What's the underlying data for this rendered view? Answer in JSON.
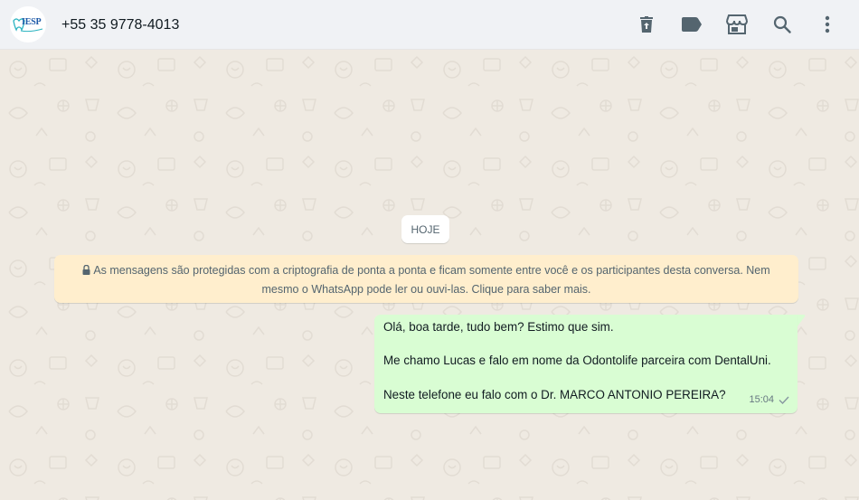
{
  "header": {
    "avatar_logo_text": "IESP",
    "contact_name": "+55 35 9778-4013",
    "icons": [
      "delete-icon",
      "label-icon",
      "store-icon",
      "search-icon",
      "menu-icon"
    ]
  },
  "chat": {
    "date_divider": "HOJE",
    "encryption_notice": "As mensagens são protegidas com a criptografia de ponta a ponta e ficam somente entre você e os participantes desta conversa. Nem mesmo o WhatsApp pode ler ou ouvi-las. Clique para saber mais.",
    "messages": [
      {
        "direction": "outgoing",
        "lines": [
          "Olá, boa tarde, tudo bem? Estimo que sim.",
          "Me chamo Lucas e falo em nome da Odontolife parceira com DentalUni.",
          "Neste telefone eu falo com o Dr. MARCO ANTONIO PEREIRA?"
        ],
        "time": "15:04",
        "status": "sent"
      }
    ]
  },
  "colors": {
    "header_bg": "#f0f2f5",
    "chat_bg": "#efeae2",
    "outgoing_bubble": "#d9fdd3",
    "system_notice_bg": "#ffeecd",
    "icon_gray": "#54656f"
  }
}
